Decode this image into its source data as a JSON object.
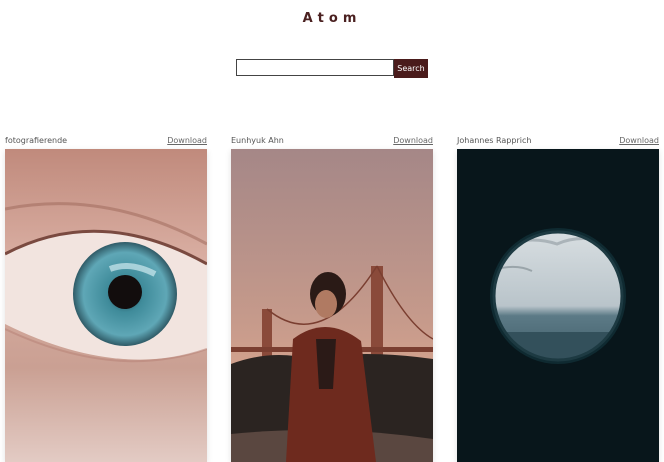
{
  "header": {
    "brand": "Atom"
  },
  "search": {
    "placeholder": "",
    "value": "",
    "button_label": "Search"
  },
  "cards": [
    {
      "author": "fotografierende",
      "download_label": "Download",
      "photo": "close-up of a blue eye"
    },
    {
      "author": "Eunhyuk Ahn",
      "download_label": "Download",
      "photo": "woman in front of the Golden Gate Bridge at dusk"
    },
    {
      "author": "Johannes Rapprich",
      "download_label": "Download",
      "photo": "sea seen through a round porthole"
    }
  ],
  "colors": {
    "brand": "#4a2020",
    "accent": "#4a1b1b"
  }
}
